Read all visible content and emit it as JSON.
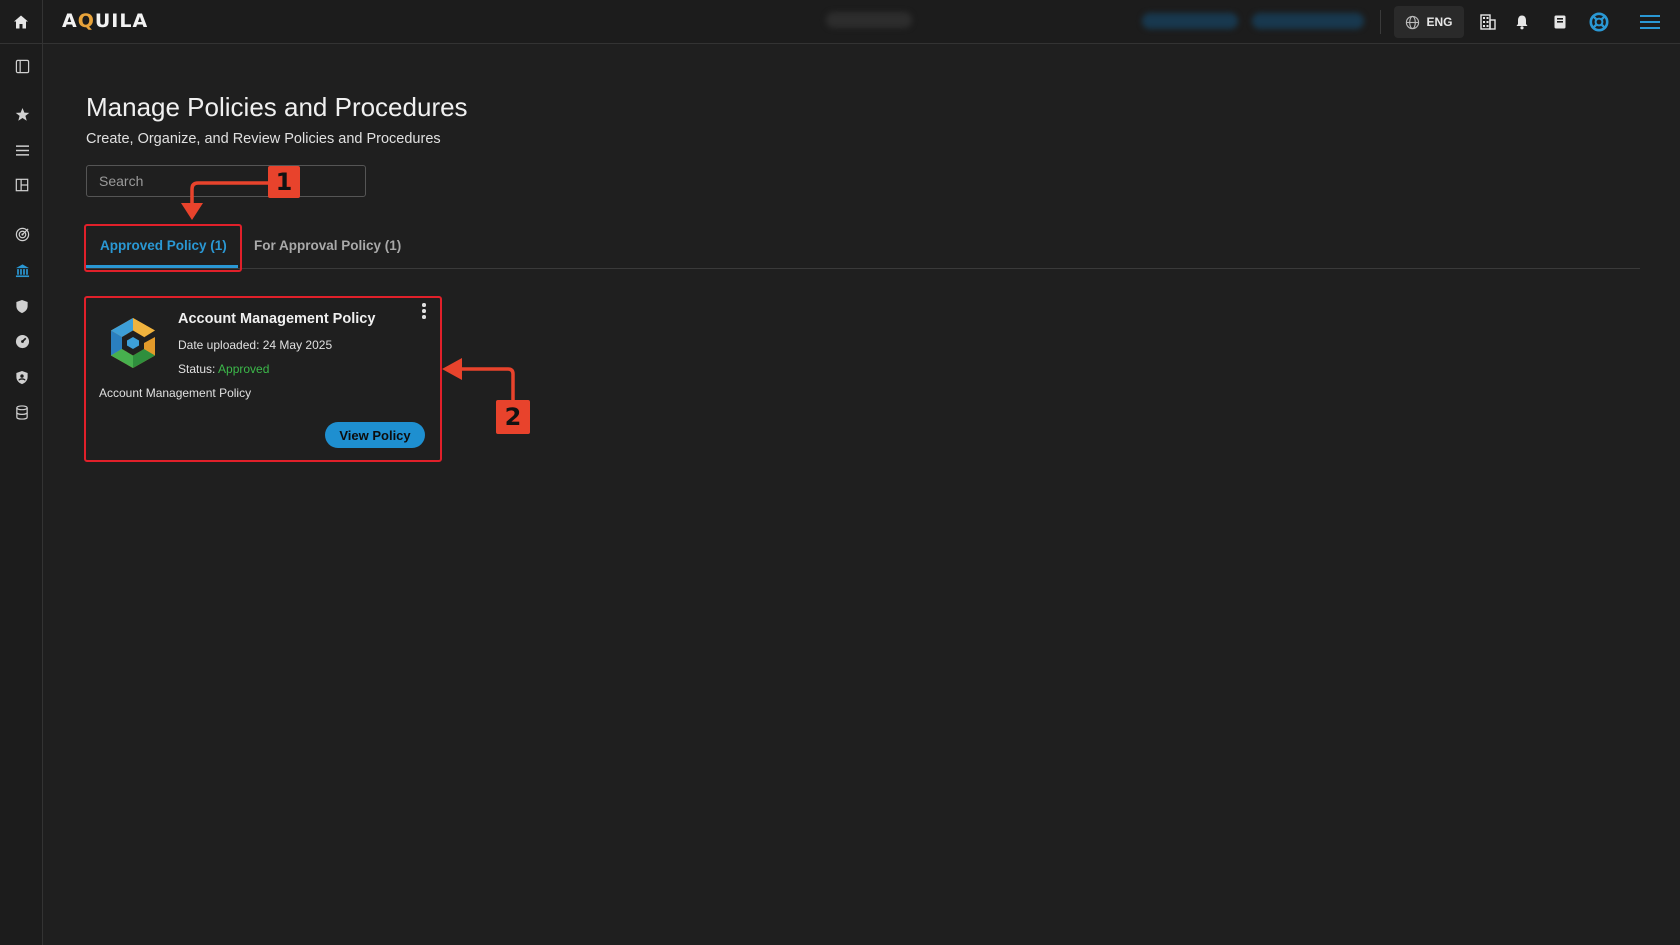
{
  "app": {
    "brand": "AQUILA"
  },
  "topbar": {
    "language": "ENG",
    "icons": [
      "home-icon",
      "globe-icon",
      "building-icon",
      "bell-icon",
      "notebook-icon",
      "lifebuoy-icon",
      "hamburger-menu-icon"
    ]
  },
  "sidebar": {
    "items": [
      {
        "icon": "panel-toggle-icon"
      },
      {
        "icon": "star-icon"
      },
      {
        "icon": "list-icon"
      },
      {
        "icon": "layout-grid-icon"
      },
      {
        "icon": "target-icon"
      },
      {
        "icon": "bank-icon",
        "active": true
      },
      {
        "icon": "shield-icon"
      },
      {
        "icon": "gauge-icon"
      },
      {
        "icon": "shield-badge-icon"
      },
      {
        "icon": "database-icon"
      }
    ]
  },
  "page": {
    "title": "Manage Policies and Procedures",
    "subtitle": "Create, Organize, and Review Policies and Procedures",
    "search": {
      "placeholder": "Search",
      "value": ""
    }
  },
  "tabs": [
    {
      "label": "Approved Policy (1)",
      "active": true
    },
    {
      "label": "For Approval Policy (1)",
      "active": false
    }
  ],
  "policy_card": {
    "title": "Account Management Policy",
    "date_uploaded": "Date uploaded: 24 May 2025",
    "status_label": "Status:",
    "status_value": "Approved",
    "description": "Account Management Policy",
    "button_label": "View Policy"
  },
  "callouts": [
    {
      "number": "1"
    },
    {
      "number": "2"
    }
  ],
  "colors": {
    "accent": "#2a98d4",
    "approved": "#3cb94a",
    "callout": "#e8432c",
    "highlight_border": "#e0202a"
  }
}
